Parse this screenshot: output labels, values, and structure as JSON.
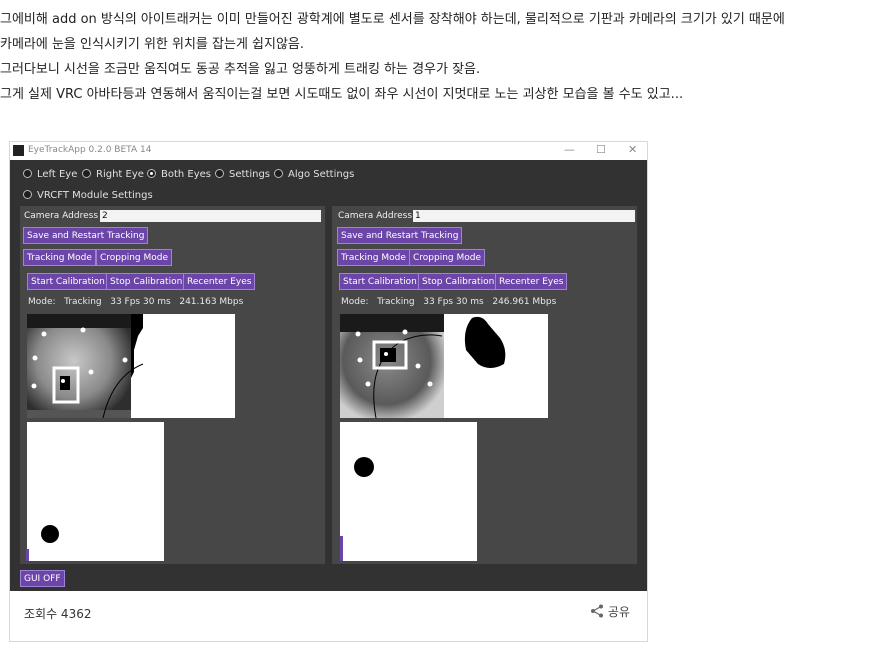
{
  "post": {
    "lines": [
      "그에비해 add on 방식의 아이트래커는 이미 만들어진 광학계에 별도로 센서를 장착해야 하는데, 물리적으로 기판과 카메라의 크기가 있기 때문에",
      "카메라에 눈을 인식시키기 위한 위치를 잡는게 쉽지않음.",
      "그러다보니 시선을 조금만 움직여도 동공 추적을 잃고 엉뚱하게 트래킹 하는 경우가 잦음.",
      "그게 실제 VRC 아바타등과 연동해서 움직이는걸 보면 시도때도 없이 좌우 시선이 지멋대로 노는 괴상한 모습을 볼 수도 있고..."
    ]
  },
  "app": {
    "title": "EyeTrackApp 0.2.0 BETA 14",
    "window_buttons": {
      "minimize": "—",
      "maximize": "☐",
      "close": "✕"
    },
    "radios": [
      {
        "label": "Left Eye",
        "selected": false
      },
      {
        "label": "Right Eye",
        "selected": false
      },
      {
        "label": "Both Eyes",
        "selected": true
      },
      {
        "label": "Settings",
        "selected": false
      },
      {
        "label": "Algo Settings",
        "selected": false
      },
      {
        "label": "VRCFT Module Settings",
        "selected": false
      }
    ],
    "panels": [
      {
        "camera_label": "Camera Address",
        "camera_value": "2",
        "save_restart": "Save and Restart Tracking",
        "tracking_mode": "Tracking Mode",
        "cropping_mode": "Cropping Mode",
        "start_calibration": "Start Calibration",
        "stop_calibration": "Stop Calibration",
        "recenter_eyes": "Recenter Eyes",
        "status": {
          "mode_label": "Mode:",
          "mode": "Tracking",
          "fps": "33 Fps 30 ms",
          "bandwidth": "241.163 Mbps"
        }
      },
      {
        "camera_label": "Camera Address",
        "camera_value": "1",
        "save_restart": "Save and Restart Tracking",
        "tracking_mode": "Tracking Mode",
        "cropping_mode": "Cropping Mode",
        "start_calibration": "Start Calibration",
        "stop_calibration": "Stop Calibration",
        "recenter_eyes": "Recenter Eyes",
        "status": {
          "mode_label": "Mode:",
          "mode": "Tracking",
          "fps": "33 Fps 30 ms",
          "bandwidth": "246.961 Mbps"
        }
      }
    ],
    "gui_off": "GUI OFF",
    "colors": {
      "background": "#323232",
      "panel": "#474747",
      "button": "#6b46a8",
      "button_border": "#9f82d6"
    }
  },
  "footer": {
    "views_label": "조회수 4362",
    "share_label": "공유",
    "share_icon": "share-icon"
  }
}
